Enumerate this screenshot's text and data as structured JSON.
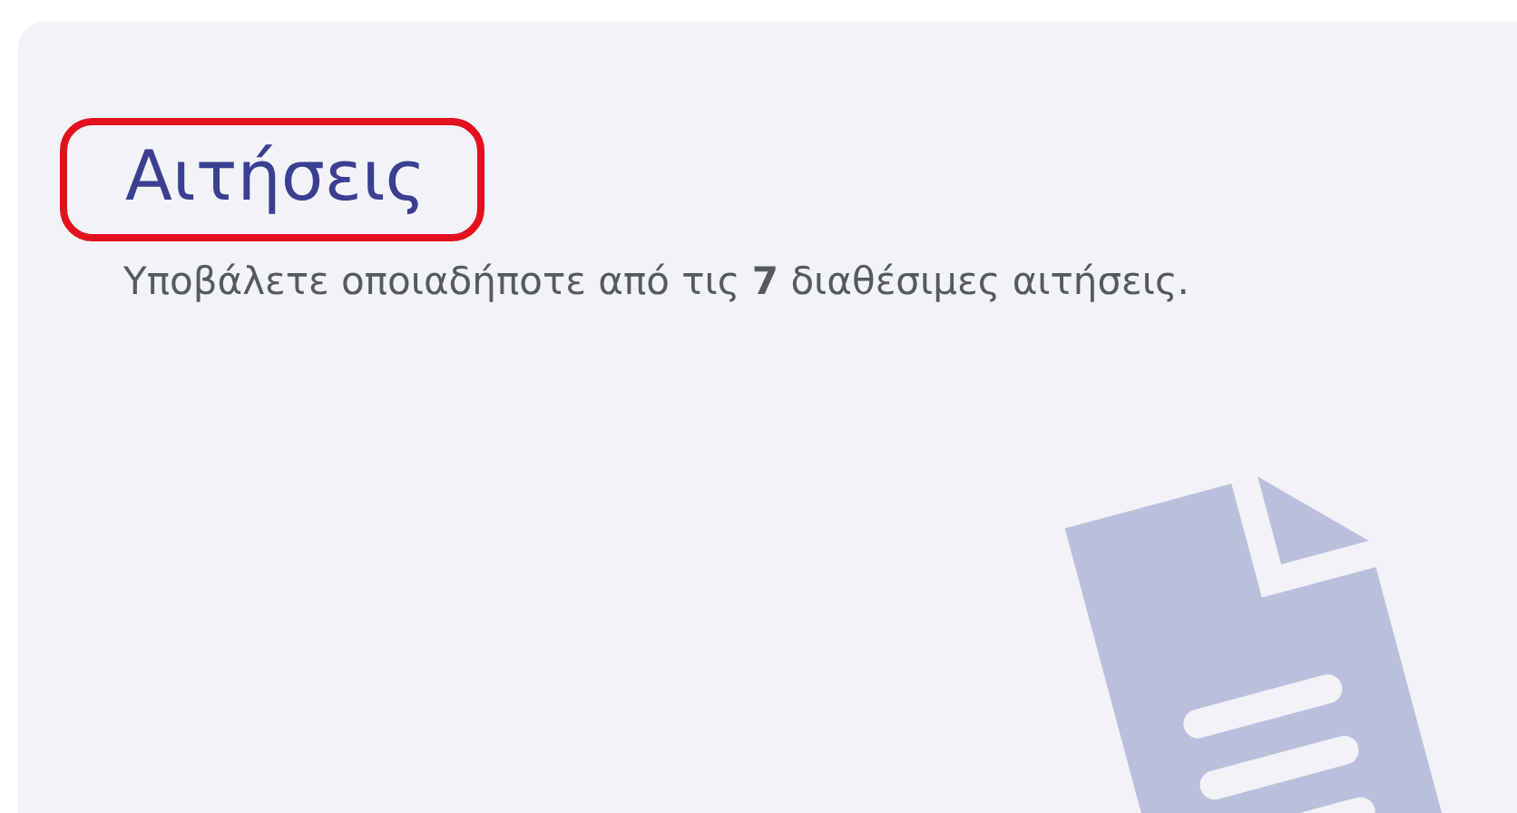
{
  "card": {
    "title": "Αιτήσεις",
    "title_highlighted": true,
    "description": "Υποβάλετε οποιαδήποτε από τις **7** διαθέσιμες αιτήσεις."
  }
}
